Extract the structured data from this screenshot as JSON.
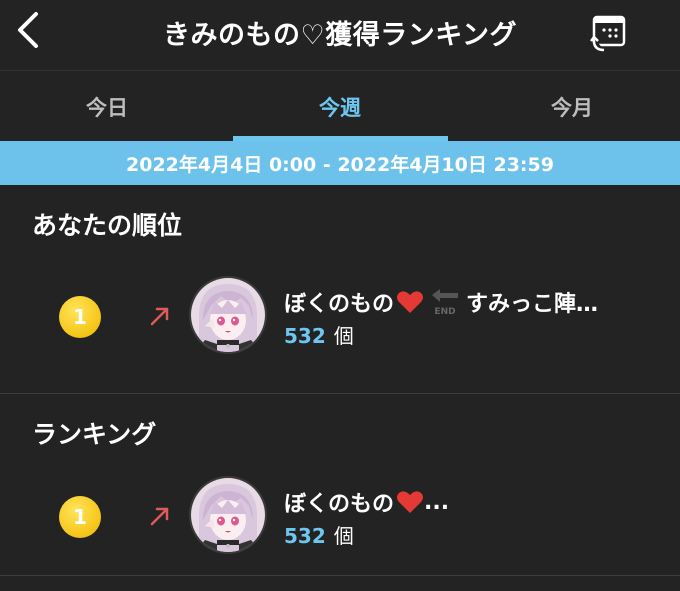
{
  "header": {
    "title": "きみのもの♡獲得ランキング",
    "back_icon": "chevron-left-icon",
    "calendar_icon": "calendar-return-icon"
  },
  "tabs": [
    {
      "label": "今日",
      "active": false
    },
    {
      "label": "今週",
      "active": true
    },
    {
      "label": "今月",
      "active": false
    }
  ],
  "date_range": "2022年4月4日 0:00 - 2022年4月10日 23:59",
  "your_rank": {
    "section_title": "あなたの順位",
    "rank": "1",
    "trend": "up",
    "name_part1": "ぼくのもの",
    "end_label": "END",
    "name_part2": "すみっこ陣…",
    "count": "532",
    "unit": "個"
  },
  "ranking": {
    "section_title": "ランキング",
    "items": [
      {
        "rank": "1",
        "trend": "up",
        "name_part1": "ぼくのもの",
        "name_suffix": "...",
        "count": "532",
        "unit": "個"
      }
    ]
  },
  "colors": {
    "accent": "#6ec6f0",
    "date_bar": "#6cc2ea",
    "background": "#232323",
    "rank_gold": "#f5c516",
    "trend_up": "#e05a5a",
    "heart": "#e53935"
  }
}
